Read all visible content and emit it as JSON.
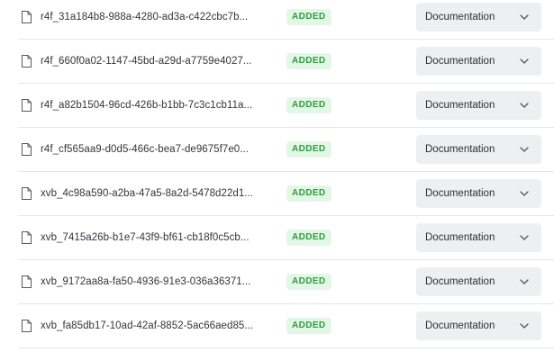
{
  "files": [
    {
      "name": "r4f_31a184b8-988a-4280-ad3a-c422cbc7b...",
      "status": "ADDED",
      "type": "Documentation"
    },
    {
      "name": "r4f_660f0a02-1147-45bd-a29d-a7759e4027...",
      "status": "ADDED",
      "type": "Documentation"
    },
    {
      "name": "r4f_a82b1504-96cd-426b-b1bb-7c3c1cb11a...",
      "status": "ADDED",
      "type": "Documentation"
    },
    {
      "name": "r4f_cf565aa9-d0d5-466c-bea7-de9675f7e0...",
      "status": "ADDED",
      "type": "Documentation"
    },
    {
      "name": "xvb_4c98a590-a2ba-47a5-8a2d-5478d22d1...",
      "status": "ADDED",
      "type": "Documentation"
    },
    {
      "name": "xvb_7415a26b-b1e7-43f9-bf61-cb18f0c5cb...",
      "status": "ADDED",
      "type": "Documentation"
    },
    {
      "name": "xvb_9172aa8a-fa50-4936-91e3-036a36371...",
      "status": "ADDED",
      "type": "Documentation"
    },
    {
      "name": "xvb_fa85db17-10ad-42af-8852-5ac66aed85...",
      "status": "ADDED",
      "type": "Documentation"
    }
  ],
  "icons": {
    "file": "file-icon",
    "dropdown": "chevron-down-icon"
  },
  "colors": {
    "badge_bg": "#e3f7e6",
    "badge_text": "#2f9c3f",
    "select_bg": "#eeeff1",
    "divider": "#e6e7ea"
  }
}
